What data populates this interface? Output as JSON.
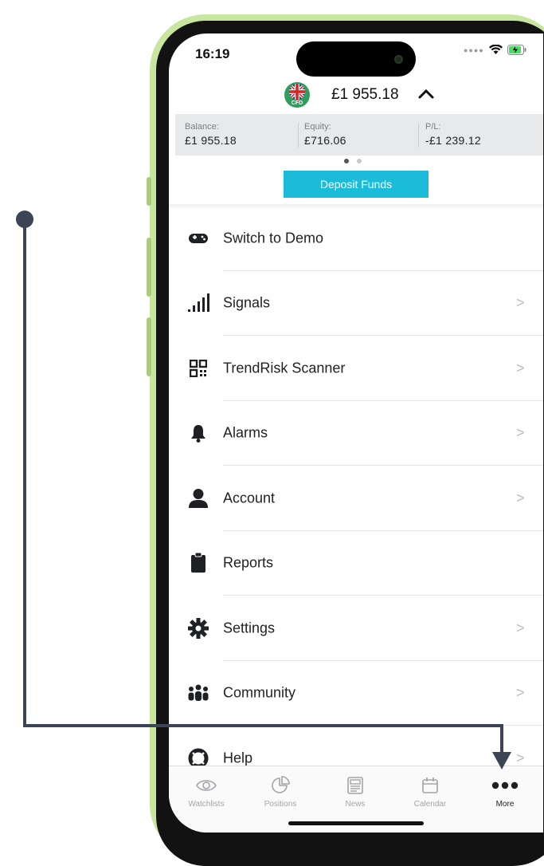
{
  "status": {
    "time": "16:19"
  },
  "account": {
    "amount": "£1 955.18",
    "flag_label": "CFD"
  },
  "summary": [
    {
      "label": "Balance:",
      "value": "£1 955.18"
    },
    {
      "label": "Equity:",
      "value": "£716.06"
    },
    {
      "label": "P/L:",
      "value": "-£1 239.12"
    }
  ],
  "deposit_label": "Deposit Funds",
  "menu": [
    {
      "label": "Switch to Demo",
      "icon": "gamepad-icon",
      "chevron": false
    },
    {
      "label": "Signals",
      "icon": "signal-bars-icon",
      "chevron": true
    },
    {
      "label": "TrendRisk Scanner",
      "icon": "qr-code-icon",
      "chevron": true
    },
    {
      "label": "Alarms",
      "icon": "bell-icon",
      "chevron": true
    },
    {
      "label": "Account",
      "icon": "user-icon",
      "chevron": true
    },
    {
      "label": "Reports",
      "icon": "clipboard-icon",
      "chevron": false
    },
    {
      "label": "Settings",
      "icon": "gear-icon",
      "chevron": true
    },
    {
      "label": "Community",
      "icon": "group-icon",
      "chevron": true
    },
    {
      "label": "Help",
      "icon": "lifebuoy-icon",
      "chevron": true
    }
  ],
  "chevron_glyph": ">",
  "tabs": [
    {
      "label": "Watchlists",
      "icon": "eye-icon"
    },
    {
      "label": "Positions",
      "icon": "pie-chart-icon"
    },
    {
      "label": "News",
      "icon": "newspaper-icon"
    },
    {
      "label": "Calendar",
      "icon": "calendar-icon"
    },
    {
      "label": "More",
      "icon": "more-dots-icon",
      "active": true
    }
  ],
  "colors": {
    "accent": "#1bbcd9",
    "annotation": "#3b4556",
    "phone_frame": "#c8e6a0"
  }
}
